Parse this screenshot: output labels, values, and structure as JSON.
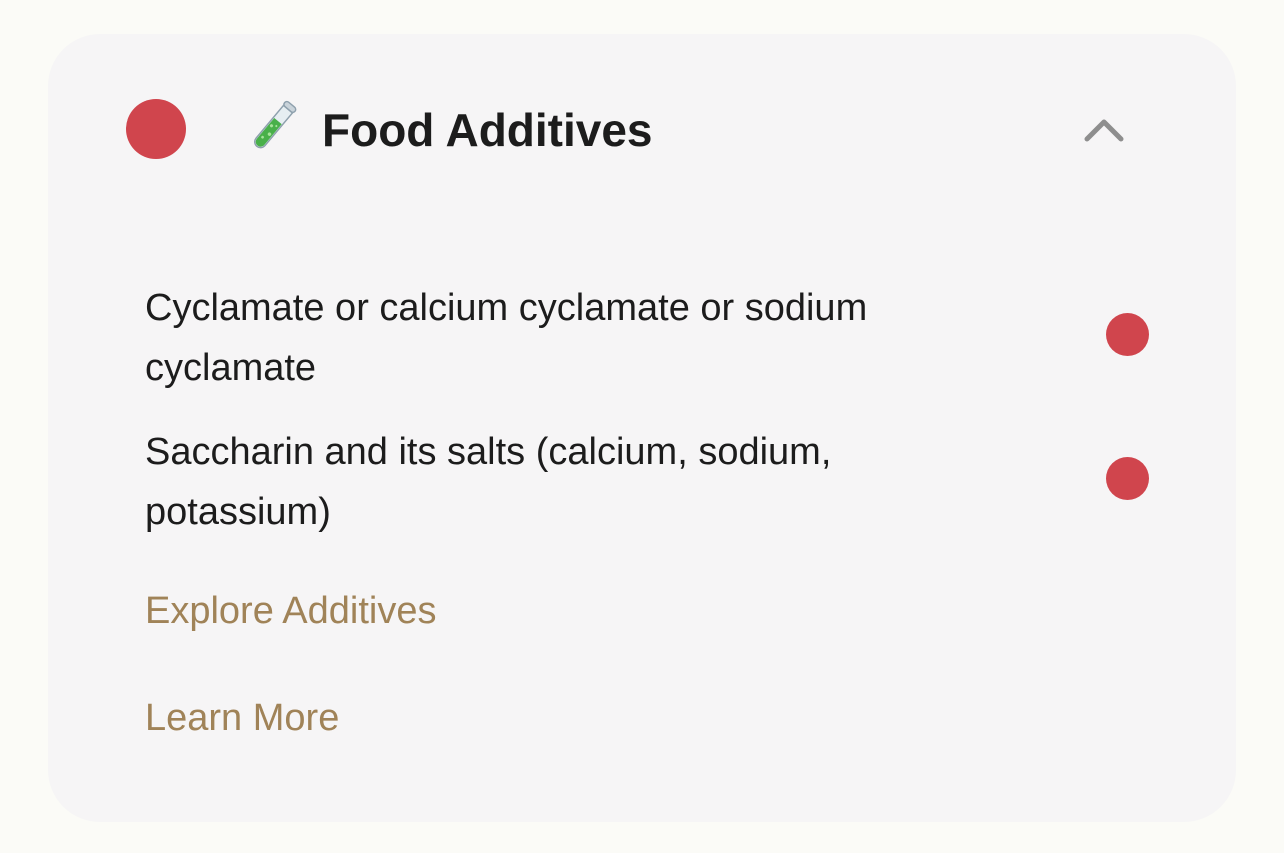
{
  "colors": {
    "status_red": "#d0454d",
    "link_gold": "#a08358",
    "text_dark": "#1c1c1c",
    "chevron_gray": "#8e8e8e"
  },
  "section": {
    "title": "Food Additives",
    "title_icon": "test-tube-icon",
    "status": "red",
    "expanded": true,
    "collapse_icon": "chevron-up-icon"
  },
  "additives": [
    {
      "label": "Cyclamate or calcium cyclamate or sodium cyclamate",
      "status": "red"
    },
    {
      "label": "Saccharin and its salts (calcium, sodium, potassium)",
      "status": "red"
    }
  ],
  "links": {
    "explore": "Explore Additives",
    "learn_more": "Learn More"
  }
}
